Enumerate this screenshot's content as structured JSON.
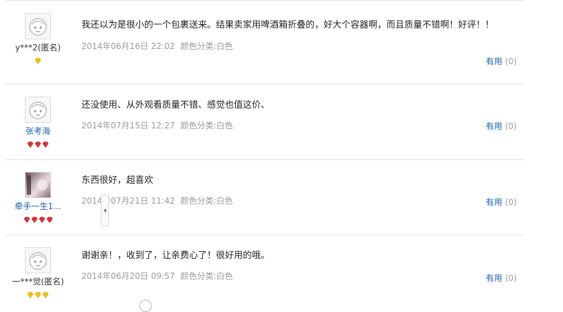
{
  "reviews": [
    {
      "username": "y***2(匿名)",
      "avatar": "default-baby-avatar",
      "level_icon": "gold-diamond-icon",
      "level_count": 1,
      "text": "我还以为是很小的一个包裹送来。结果卖家用啤酒箱折叠的，好大个容器啊，而且质量不错啊！好评！！",
      "date": "2014年06月16日 22:02",
      "sku": "颜色分类:白色",
      "useful_label": "有用",
      "useful_count": "(0)"
    },
    {
      "username": "张考海",
      "avatar": "default-baby-avatar",
      "level_icon": "red-heart-icon",
      "level_count": 3,
      "text": "还没使用、从外观看质量不错、感觉也值这价、",
      "date": "2014年07月15日 12:27",
      "sku": "颜色分类:白色",
      "useful_label": "有用",
      "useful_count": "(0)"
    },
    {
      "username": "牵手一生1...",
      "avatar": "photo-avatar",
      "level_icon": "red-heart-icon",
      "level_count": 4,
      "text": "东西很好，超喜欢",
      "date": "2014年07月21日 11:42",
      "sku": "颜色分类:白色",
      "useful_label": "有用",
      "useful_count": "(0)"
    },
    {
      "username": "一***觉(匿名)",
      "avatar": "default-baby-avatar",
      "level_icon": "gold-diamond-icon",
      "level_count": 3,
      "text": "谢谢亲！，收到了，让亲费心了！很好用的哦。",
      "date": "2014年06月20日 09:57",
      "sku": "颜色分类:白色",
      "useful_label": "有用",
      "useful_count": "(0)"
    }
  ],
  "colors": {
    "link": "#1a60b5",
    "meta": "#9a9a9a",
    "gold": "#f5c400",
    "heart": "#e0313d",
    "divider": "#e2e2e2"
  }
}
